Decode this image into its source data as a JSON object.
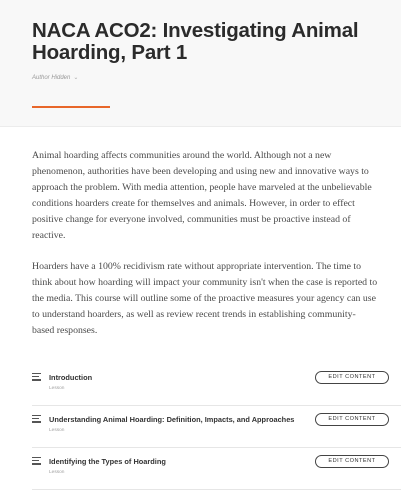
{
  "course": {
    "title": "NACA ACO2: Investigating Animal Hoarding, Part 1",
    "author": "Author Hidden",
    "author_chevron": "⌄"
  },
  "description": {
    "paragraphs": [
      [
        "Animal hoarding affects communities around the world. Although not a new",
        "phenomenon, authorities have been developing and using new and innovative ways to",
        "approach the problem. With media attention, people have marveled at the unbelievable",
        "conditions hoarders create for themselves and animals. However, in order to effect",
        "positive change for everyone involved, communities must be proactive instead of",
        "reactive."
      ],
      [
        "Hoarders have a 100% recidivism rate without appropriate intervention. The time to",
        "think about how hoarding will impact your community isn't when the case is reported to",
        "the media. This course will outline some of the proactive measures your agency can use",
        "to understand hoarders, as well as review recent trends in establishing community-",
        "based responses."
      ]
    ]
  },
  "lessons": [
    {
      "title": "Introduction",
      "type": "Lesson",
      "action": "EDIT CONTENT"
    },
    {
      "title": "Understanding Animal Hoarding: Definition, Impacts, and Approaches",
      "type": "Lesson",
      "action": "EDIT CONTENT"
    },
    {
      "title": "Identifying the Types of Hoarding",
      "type": "Lesson",
      "action": "EDIT CONTENT"
    }
  ],
  "colors": {
    "accent": "#e8672a",
    "header_bg": "#f8f8f8"
  }
}
